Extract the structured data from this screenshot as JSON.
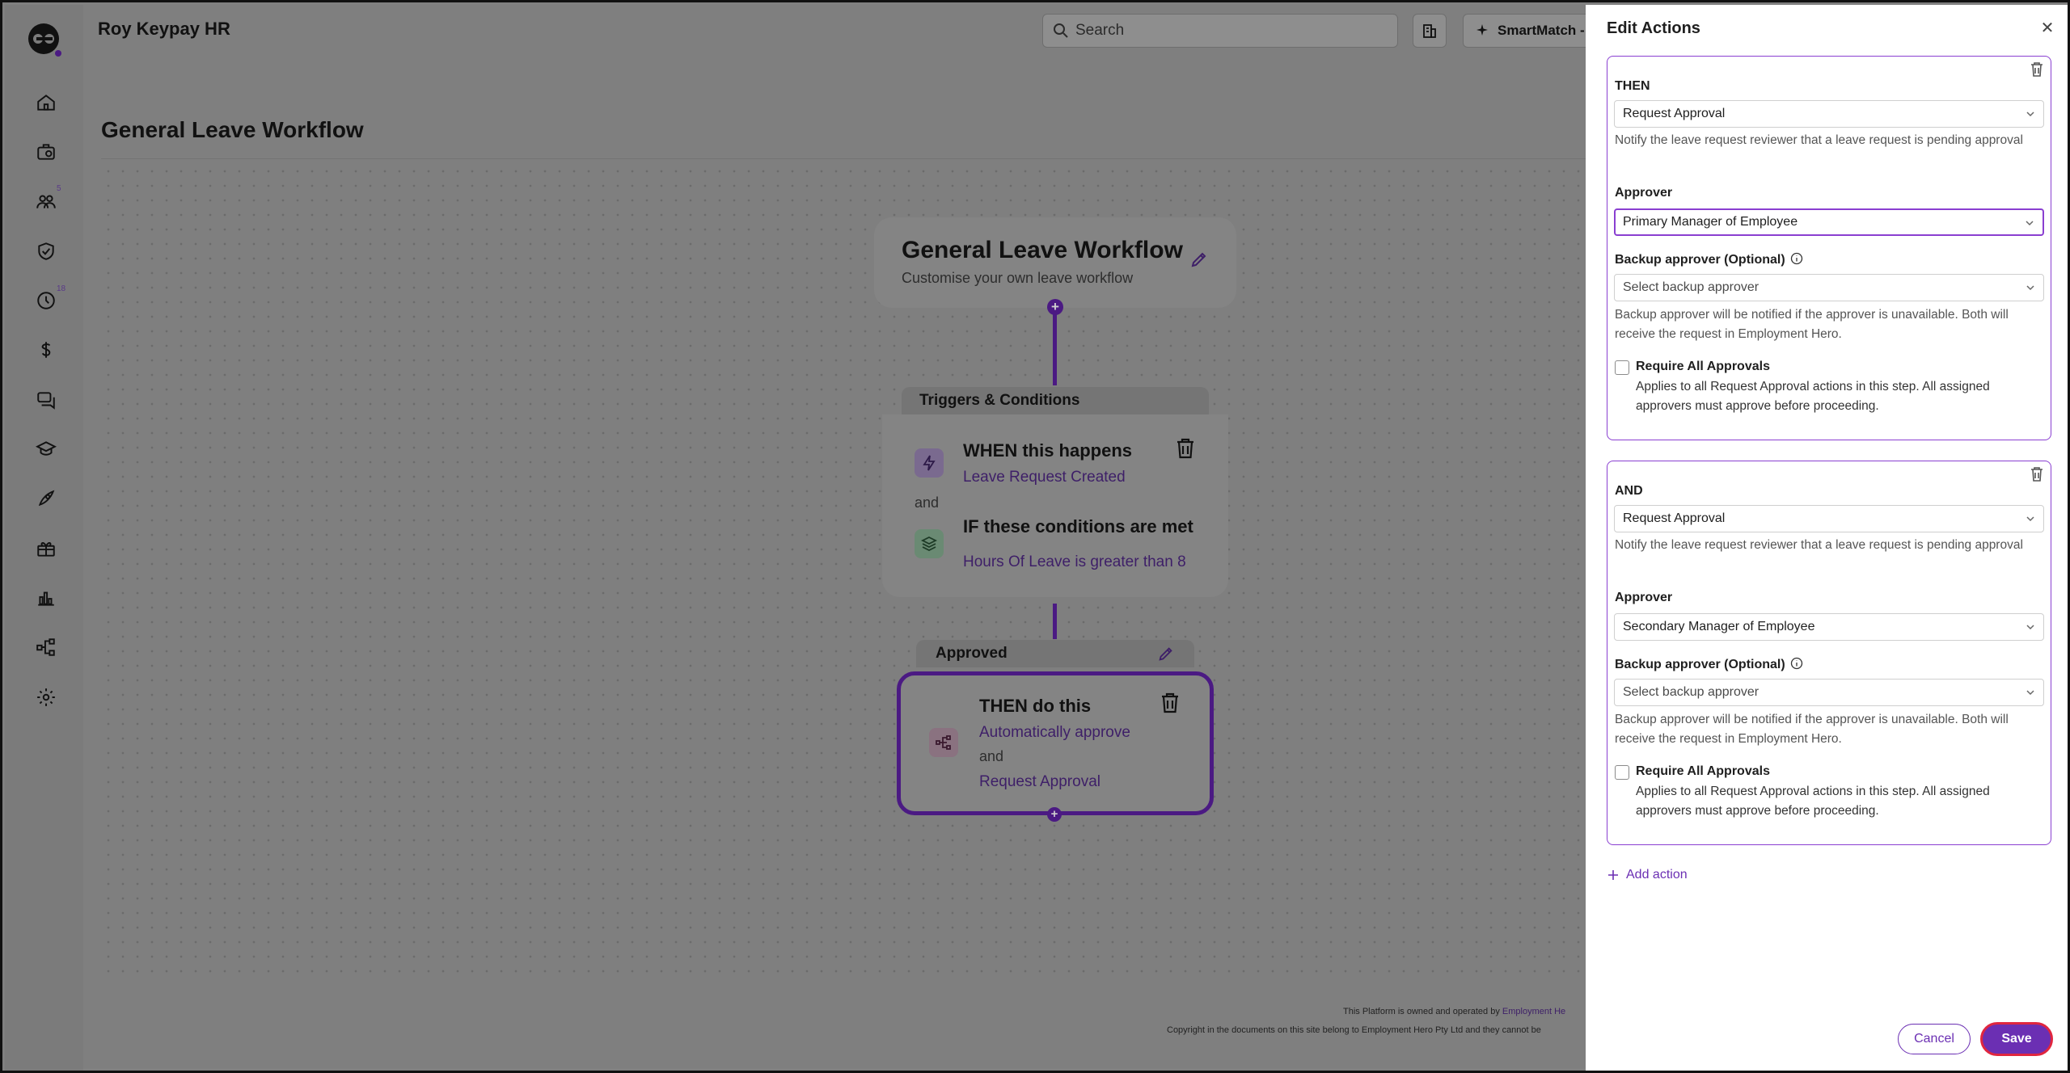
{
  "app": {
    "org_name": "Roy Keypay HR",
    "search_placeholder": "Search",
    "smartmatch_label": "SmartMatch -",
    "sidebar_badges": {
      "people": "5",
      "time": "18"
    }
  },
  "page": {
    "title": "General Leave Workflow"
  },
  "workflow": {
    "title": "General Leave Workflow",
    "subtitle": "Customise your own leave workflow",
    "triggers_header": "Triggers & Conditions",
    "when_title": "WHEN this happens",
    "when_value": "Leave Request Created",
    "and_label": "and",
    "if_title": "IF these conditions are met",
    "if_value": "Hours Of Leave is greater than 8",
    "approved_header": "Approved",
    "then_title": "THEN do this",
    "then_action_1": "Automatically approve",
    "then_and": "and",
    "then_action_2": "Request Approval"
  },
  "footer": {
    "line1_prefix": "This Platform is owned and operated by",
    "line1_link": "Employment He",
    "line2": "Copyright in the documents on this site belong to Employment Hero Pty Ltd and they cannot be"
  },
  "drawer": {
    "title": "Edit Actions",
    "actions": [
      {
        "heading": "THEN",
        "action_value": "Request Approval",
        "action_helper": "Notify the leave request reviewer that a leave request is pending approval",
        "approver_label": "Approver",
        "approver_value": "Primary Manager of Employee",
        "backup_label": "Backup approver (Optional)",
        "backup_placeholder": "Select backup approver",
        "backup_helper": "Backup approver will be notified if the approver is unavailable. Both will receive the request in Employment Hero.",
        "require_title": "Require All Approvals",
        "require_desc": "Applies to all Request Approval actions in this step. All assigned approvers must approve before proceeding."
      },
      {
        "heading": "AND",
        "action_value": "Request Approval",
        "action_helper": "Notify the leave request reviewer that a leave request is pending approval",
        "approver_label": "Approver",
        "approver_value": "Secondary Manager of Employee",
        "backup_label": "Backup approver (Optional)",
        "backup_placeholder": "Select backup approver",
        "backup_helper": "Backup approver will be notified if the approver is unavailable. Both will receive the request in Employment Hero.",
        "require_title": "Require All Approvals",
        "require_desc": "Applies to all Request Approval actions in this step. All assigned approvers must approve before proceeding."
      }
    ],
    "add_action_label": "Add action",
    "cancel_label": "Cancel",
    "save_label": "Save"
  },
  "colors": {
    "accent": "#6b2fb3",
    "focus_border": "#8a3fd1",
    "save_outline": "#e0263f",
    "overlay": "#808080"
  }
}
